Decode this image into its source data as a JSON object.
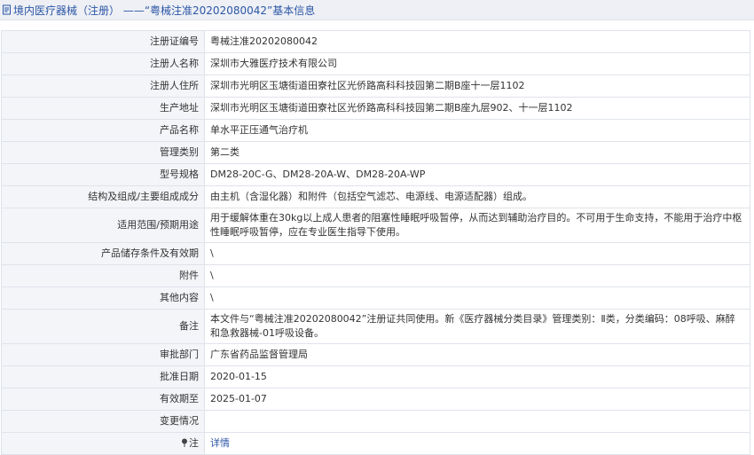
{
  "header": {
    "title": "境内医疗器械（注册）  ——“粤械注准20202080042”基本信息"
  },
  "rows": [
    {
      "label": "注册证编号",
      "value": "粤械注准20202080042"
    },
    {
      "label": "注册人名称",
      "value": "深圳市大雅医疗技术有限公司"
    },
    {
      "label": "注册人住所",
      "value": "深圳市光明区玉塘街道田寮社区光侨路高科科技园第二期B座十一层1102"
    },
    {
      "label": "生产地址",
      "value": "深圳市光明区玉塘街道田寮社区光侨路高科科技园第二期B座九层902、十一层1102"
    },
    {
      "label": "产品名称",
      "value": "单水平正压通气治疗机"
    },
    {
      "label": "管理类别",
      "value": "第二类"
    },
    {
      "label": "型号规格",
      "value": "DM28-20C-G、DM28-20A-W、DM28-20A-WP"
    },
    {
      "label": "结构及组成/主要组成成分",
      "value": "由主机（含湿化器）和附件（包括空气滤芯、电源线、电源适配器）组成。"
    },
    {
      "label": "适用范围/预期用途",
      "value": "用于缓解体重在30kg以上成人患者的阻塞性睡眠呼吸暂停，从而达到辅助治疗目的。不可用于生命支持，不能用于治疗中枢性睡眠呼吸暂停，应在专业医生指导下使用。"
    },
    {
      "label": "产品储存条件及有效期",
      "value": "\\"
    },
    {
      "label": "附件",
      "value": "\\"
    },
    {
      "label": "其他内容",
      "value": "\\"
    },
    {
      "label": "备注",
      "value": "本文件与“粤械注准20202080042”注册证共同使用。新《医疗器械分类目录》管理类别：Ⅱ类，分类编码：08呼吸、麻醉和急救器械-01呼吸设备。"
    },
    {
      "label": "审批部门",
      "value": "广东省药品监督管理局"
    },
    {
      "label": "批准日期",
      "value": "2020-01-15"
    },
    {
      "label": "有效期至",
      "value": "2025-01-07"
    },
    {
      "label": "变更情况",
      "value": ""
    },
    {
      "label": "注",
      "value": "详情"
    }
  ],
  "icons": {
    "header_icon": "document-icon",
    "note_icon": "pin-icon"
  },
  "colors": {
    "link": "#2c56a6",
    "label_bg": "#f3f5f8",
    "border": "#dfe3ea",
    "header_bg": "#eef0f5"
  }
}
